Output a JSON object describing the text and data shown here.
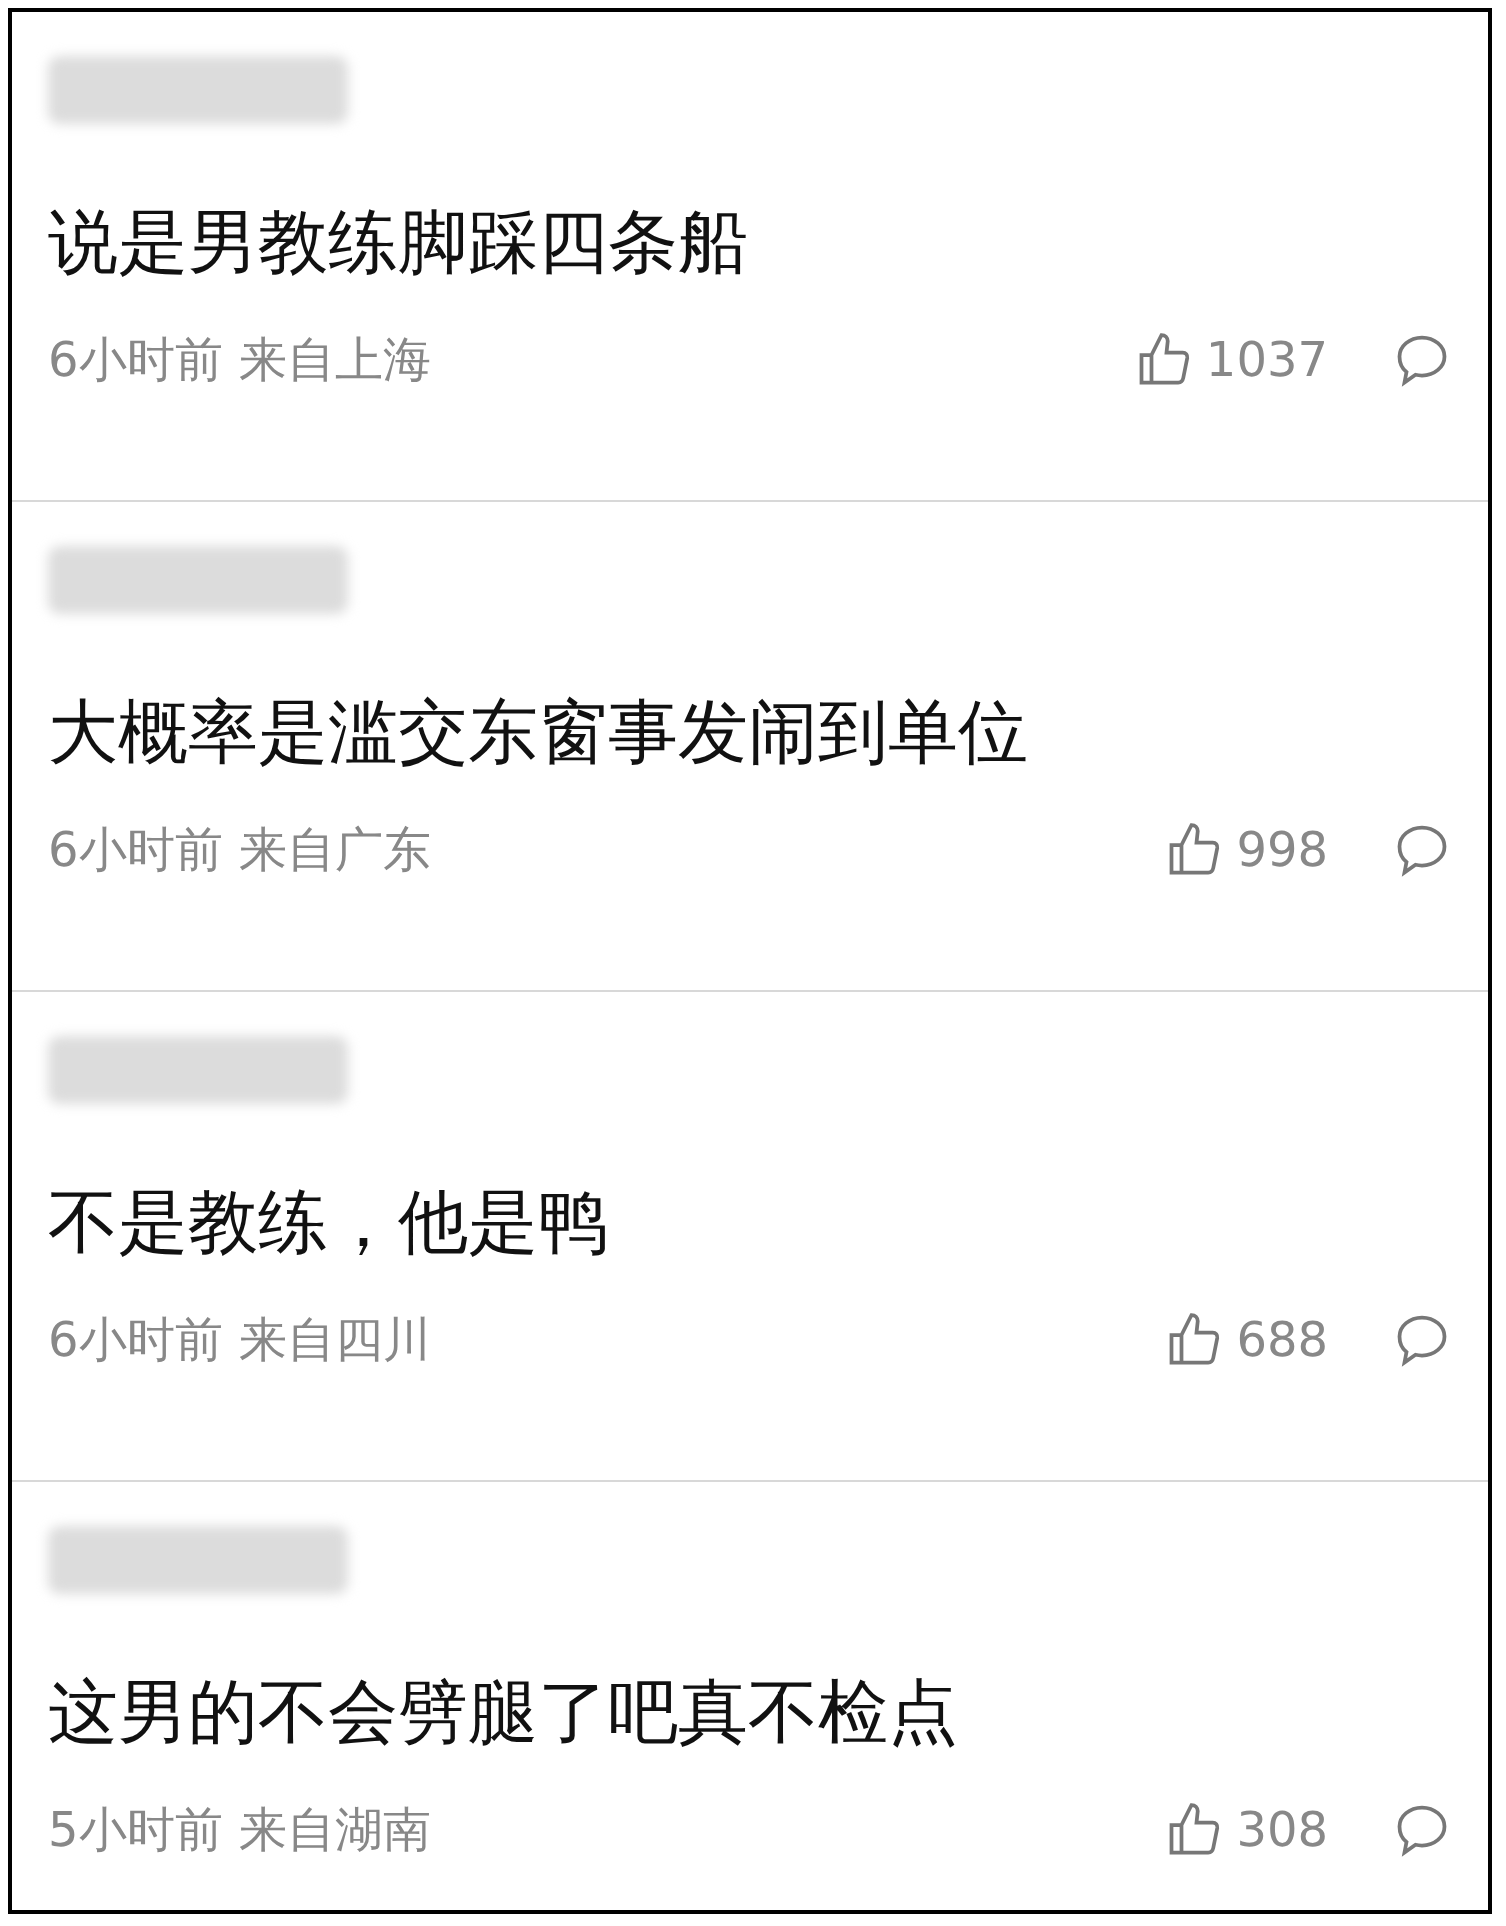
{
  "comments": [
    {
      "text": "说是男教练脚踩四条船",
      "time": "6小时前",
      "location": "来自上海",
      "likes": "1037"
    },
    {
      "text": "大概率是滥交东窗事发闹到单位",
      "time": "6小时前",
      "location": "来自广东",
      "likes": "998"
    },
    {
      "text": "不是教练，他是鸭",
      "time": "6小时前",
      "location": "来自四川",
      "likes": "688"
    },
    {
      "text": "这男的不会劈腿了吧真不检点",
      "time": "5小时前",
      "location": "来自湖南",
      "likes": "308"
    }
  ]
}
